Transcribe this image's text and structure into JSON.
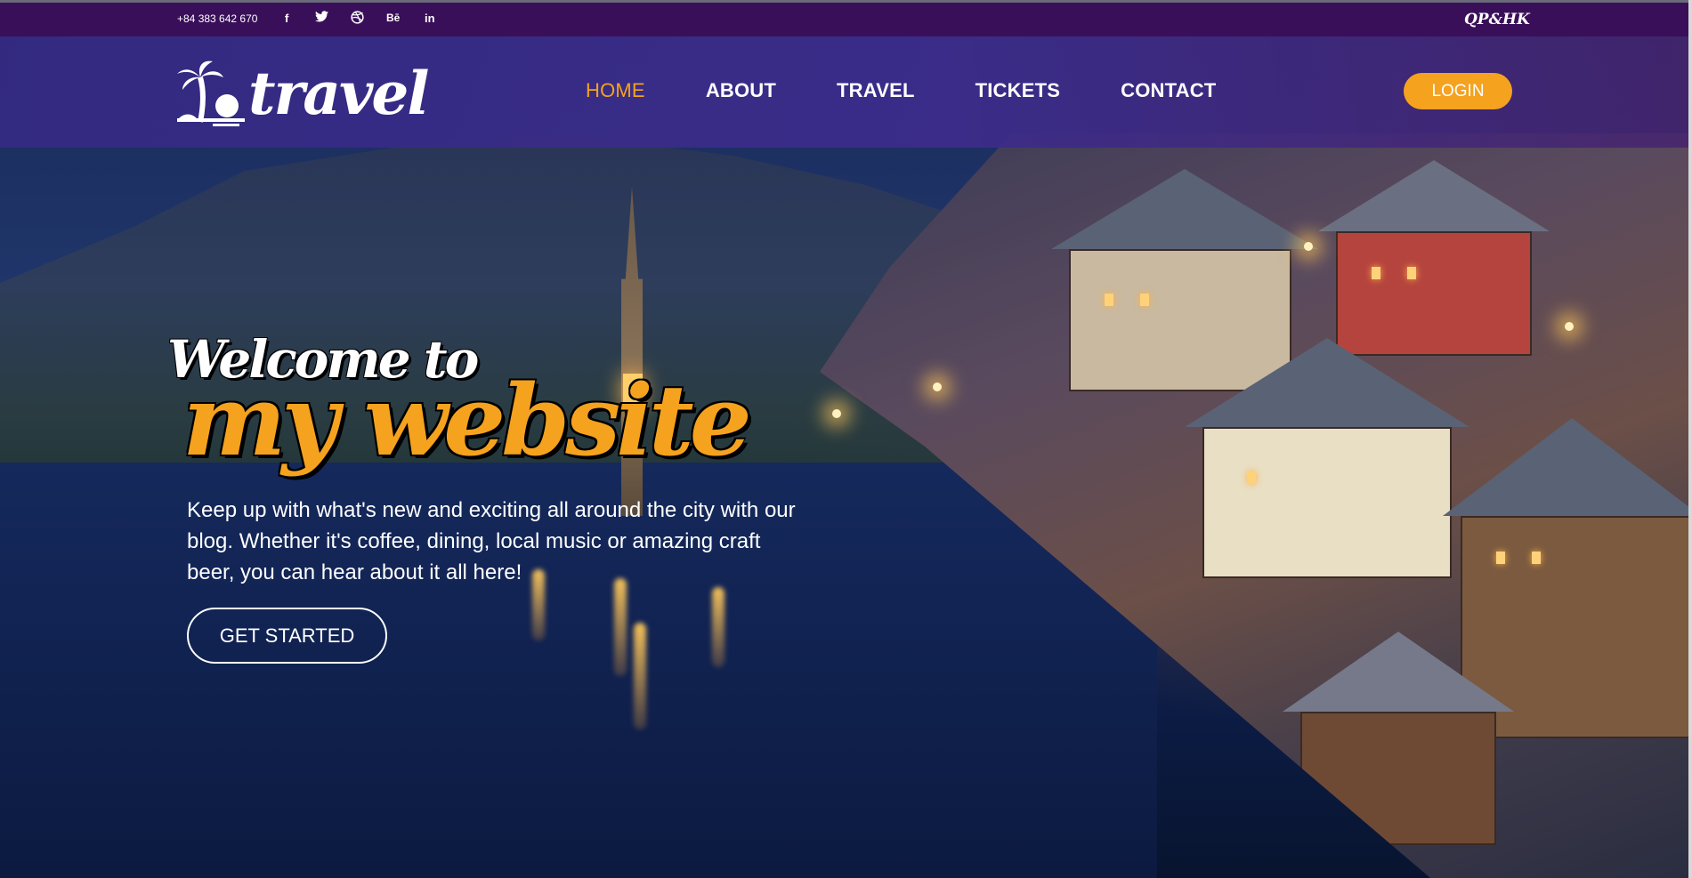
{
  "topbar": {
    "phone": "+84 383 642 670",
    "social_icons": [
      "facebook-icon",
      "twitter-icon",
      "dribbble-icon",
      "behance-icon",
      "linkedin-icon"
    ],
    "social_glyphs": {
      "facebook": "f",
      "twitter": "🐦",
      "dribbble": "⊛",
      "behance": "Bē",
      "linkedin": "in"
    },
    "brand_mark": "QP&HK"
  },
  "header": {
    "logo_text": "travel",
    "nav": [
      {
        "label": "HOME",
        "active": true
      },
      {
        "label": "ABOUT",
        "active": false
      },
      {
        "label": "TRAVEL",
        "active": false
      },
      {
        "label": "TICKETS",
        "active": false
      },
      {
        "label": "CONTACT",
        "active": false
      }
    ],
    "login_label": "LOGIN"
  },
  "hero": {
    "welcome": "Welcome to",
    "site_name": "my website",
    "description": "Keep up with what's new and exciting all around the city with our blog. Whether it's coffee, dining, local music or amazing craft beer, you can hear about it all here!",
    "cta_label": "GET STARTED"
  },
  "colors": {
    "topbar": "#3a0f5a",
    "header": "#3c2c8c",
    "accent": "#f5a21f",
    "text": "#ffffff"
  }
}
